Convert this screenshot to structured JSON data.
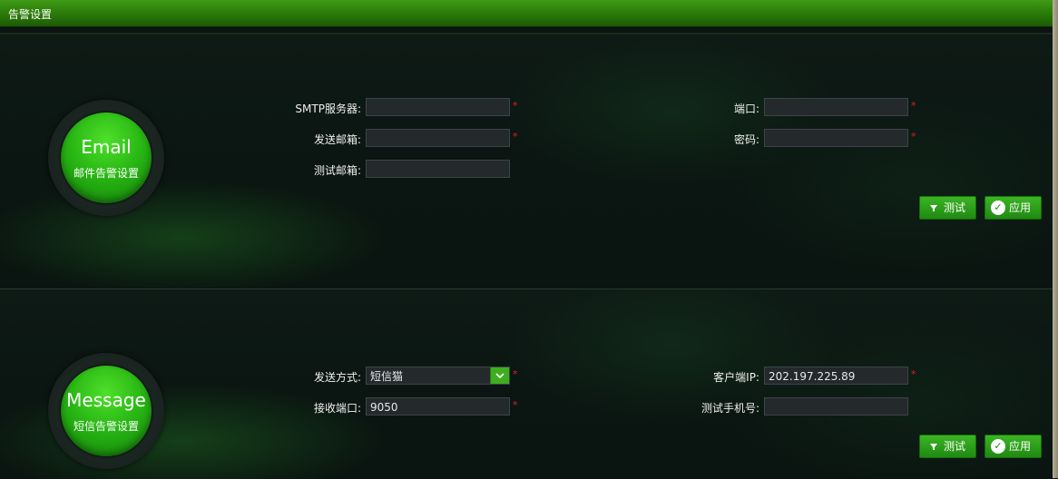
{
  "window": {
    "title": "告警设置"
  },
  "email": {
    "badge_title": "Email",
    "badge_subtitle": "邮件告警设置",
    "smtp_label": "SMTP服务器:",
    "smtp_value": "",
    "port_label": "端口:",
    "port_value": "",
    "sender_label": "发送邮箱:",
    "sender_value": "",
    "password_label": "密码:",
    "password_value": "",
    "test_mail_label": "测试邮箱:",
    "test_mail_value": "",
    "required_mark": "*",
    "test_button": "测试",
    "apply_button": "应用"
  },
  "message": {
    "badge_title": "Message",
    "badge_subtitle": "短信告警设置",
    "send_mode_label": "发送方式:",
    "send_mode_value": "短信猫",
    "client_ip_label": "客户端IP:",
    "client_ip_value": "202.197.225.89",
    "recv_port_label": "接收端口:",
    "recv_port_value": "9050",
    "test_phone_label": "测试手机号:",
    "test_phone_value": "",
    "required_mark": "*",
    "test_button": "测试",
    "apply_button": "应用"
  },
  "icons": {
    "dropdown": "chevron-down-icon",
    "test": "filter-icon",
    "apply": "check-circle-icon"
  },
  "colors": {
    "accent": "#2aa815",
    "required": "#e02020"
  }
}
